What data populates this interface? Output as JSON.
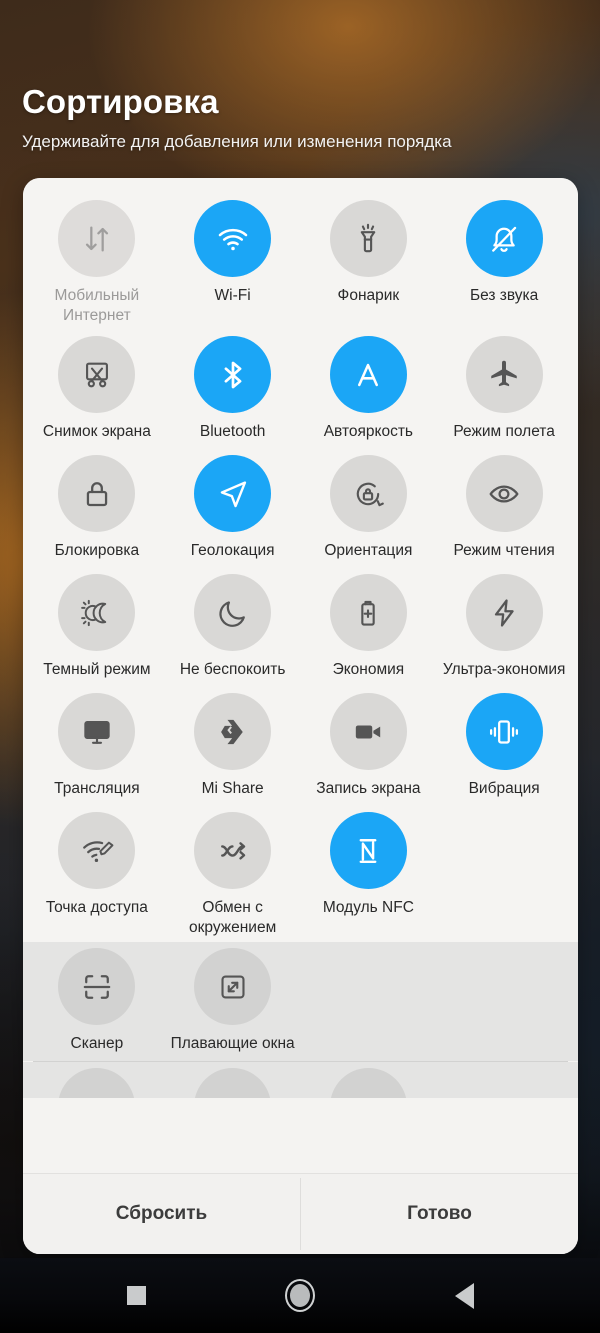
{
  "header": {
    "title": "Сортировка",
    "subtitle": "Удерживайте для добавления или изменения порядка"
  },
  "colors": {
    "accent_on": "#1ba6f6",
    "bubble_off": "#d9d8d6",
    "panel_bg": "#f5f4f2",
    "secondary_bg": "#e4e4e3",
    "label": "#2a2a2a",
    "label_dim": "#9b9a99"
  },
  "sections": [
    {
      "name": "active-tiles",
      "tiles": [
        {
          "label": "Мобильный Интернет",
          "icon": "mobile-data-icon",
          "state": "dim"
        },
        {
          "label": "Wi-Fi",
          "icon": "wifi-icon",
          "state": "on"
        },
        {
          "label": "Фонарик",
          "icon": "flashlight-icon",
          "state": "off"
        },
        {
          "label": "Без звука",
          "icon": "mute-bell-icon",
          "state": "on"
        },
        {
          "label": "Снимок экрана",
          "icon": "screenshot-icon",
          "state": "off"
        },
        {
          "label": "Bluetooth",
          "icon": "bluetooth-icon",
          "state": "on"
        },
        {
          "label": "Автояркость",
          "icon": "auto-brightness-icon",
          "state": "on"
        },
        {
          "label": "Режим полета",
          "icon": "airplane-icon",
          "state": "off"
        },
        {
          "label": "Блокировка",
          "icon": "lock-icon",
          "state": "off"
        },
        {
          "label": "Геолокация",
          "icon": "location-arrow-icon",
          "state": "on"
        },
        {
          "label": "Ориентация",
          "icon": "rotation-lock-icon",
          "state": "off"
        },
        {
          "label": "Режим чтения",
          "icon": "eye-icon",
          "state": "off"
        },
        {
          "label": "Темный режим",
          "icon": "dark-mode-icon",
          "state": "off"
        },
        {
          "label": "Не беспокоить",
          "icon": "moon-icon",
          "state": "off"
        },
        {
          "label": "Экономия",
          "icon": "battery-saver-icon",
          "state": "off"
        },
        {
          "label": "Ультра-экономия",
          "icon": "ultra-saver-icon",
          "state": "off"
        },
        {
          "label": "Трансляция",
          "icon": "cast-icon",
          "state": "off"
        },
        {
          "label": "Mi Share",
          "icon": "mi-share-icon",
          "state": "off"
        },
        {
          "label": "Запись экрана",
          "icon": "screen-record-icon",
          "state": "off"
        },
        {
          "label": "Вибрация",
          "icon": "vibration-icon",
          "state": "on"
        },
        {
          "label": "Точка доступа",
          "icon": "hotspot-icon",
          "state": "off"
        },
        {
          "label": "Обмен с окружением",
          "icon": "nearby-share-icon",
          "state": "off"
        },
        {
          "label": "Модуль NFC",
          "icon": "nfc-icon",
          "state": "on"
        },
        {
          "label": "",
          "icon": "",
          "state": "empty"
        }
      ]
    },
    {
      "name": "inactive-tiles",
      "tiles": [
        {
          "label": "Сканер",
          "icon": "scanner-icon",
          "state": "off"
        },
        {
          "label": "Плавающие окна",
          "icon": "floating-window-icon",
          "state": "off"
        },
        {
          "label": "",
          "icon": "",
          "state": "empty"
        },
        {
          "label": "",
          "icon": "",
          "state": "empty"
        }
      ]
    }
  ],
  "peek_row": {
    "name": "partially-visible-row",
    "cells": [
      "visible",
      "visible",
      "visible",
      "hidden"
    ]
  },
  "footer": {
    "reset_label": "Сбросить",
    "done_label": "Готово"
  },
  "navbar": {
    "recents_label": "recents-square-icon",
    "home_label": "home-circle-icon",
    "back_label": "back-triangle-icon"
  }
}
